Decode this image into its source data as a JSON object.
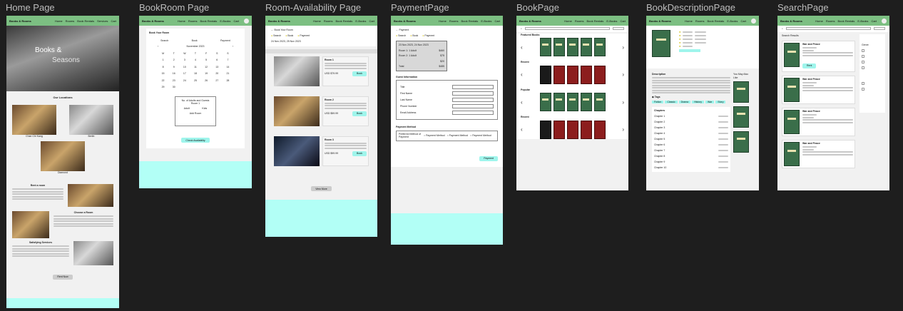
{
  "frames": {
    "home": {
      "label": "Home Page"
    },
    "bookroom": {
      "label": "BookRoom Page"
    },
    "availability": {
      "label": "Room-Availability Page"
    },
    "payment": {
      "label": "PaymentPage"
    },
    "book": {
      "label": "BookPage"
    },
    "description": {
      "label": "BookDescriptionPage"
    },
    "search": {
      "label": "SearchPage"
    }
  },
  "nav": {
    "brand": "Books & Rooms",
    "items": [
      "Home",
      "Rooms",
      "Book Rentals",
      "Services",
      "Cart"
    ],
    "items_alt": [
      "Home",
      "Rooms",
      "Book Rentals",
      "E-Books",
      "Cart"
    ]
  },
  "home": {
    "hero_line1": "Books &",
    "hero_line2": "Seasons",
    "locations_title": "Our Locations",
    "locations": [
      "Chan Chi Kang",
      "Berlin",
      "Diamond"
    ],
    "rent_title": "Rent a room",
    "choose_title": "Choose a Room",
    "services_title": "Satisfying Services",
    "rent_button": "Rent Now"
  },
  "bookroom": {
    "title": "Book Your Room",
    "steps": [
      "Search",
      "Book",
      "Payment"
    ],
    "month": "November 2023",
    "weekdays": [
      "M",
      "T",
      "W",
      "T",
      "F",
      "S",
      "S"
    ],
    "guests_title": "No. of Adults and Guests",
    "room": "Room 1",
    "adults": "Adult",
    "kids": "Kids",
    "add_room": "Add Room",
    "check_button": "Check Availability"
  },
  "availability": {
    "back": "Book Your Room",
    "steps": [
      "Search",
      "Book",
      "Payment"
    ],
    "dates": "24 Nov 2023, 25 Nov 2023",
    "rooms": [
      {
        "name": "Room 1",
        "price": "USD $79.99",
        "button": "Book"
      },
      {
        "name": "Room 2",
        "price": "USD $59.99",
        "button": "Book"
      },
      {
        "name": "Room 3",
        "price": "USD $99.99",
        "button": "Book"
      }
    ],
    "view_more": "View More"
  },
  "payment": {
    "back": "Payment",
    "steps": [
      "Search",
      "Book",
      "Payment"
    ],
    "summary_dates": "23 Nov 2023, 24 Nov 2023",
    "summary_rows": [
      {
        "label": "Room 1: 1 Adult",
        "value": "$460"
      },
      {
        "label": "Room 2: 1 Adult",
        "value": "$75"
      },
      {
        "label": "",
        "value": "$20"
      },
      {
        "label": "Total",
        "value": "$485"
      }
    ],
    "guest_title": "Guest Information",
    "fields": [
      "Title",
      "First Name",
      "Last Name",
      "Phone Number",
      "Email Address"
    ],
    "method_title": "Payment Method",
    "preferred": "Preferred Method of Payment",
    "methods": [
      "Payment Method",
      "Payment Method",
      "Payment Method"
    ],
    "pay_button": "Payment"
  },
  "book": {
    "sections": [
      "Featured Books",
      "Recent",
      "Popular",
      "Recent"
    ]
  },
  "description": {
    "description_title": "Description",
    "tags_title": "Tags",
    "tags": [
      "Fiction",
      "Classic",
      "Drama",
      "History",
      "War",
      "Story"
    ],
    "chapters_title": "Chapters",
    "chapters": [
      "Chapter 1",
      "Chapter 2",
      "Chapter 3",
      "Chapter 4",
      "Chapter 5",
      "Chapter 6",
      "Chapter 7",
      "Chapter 8",
      "Chapter 9",
      "Chapter 10"
    ],
    "side_title": "You May Also Like"
  },
  "search": {
    "results_title": "Search Results",
    "results": [
      {
        "title": "War and Peace",
        "button": "Rent"
      },
      {
        "title": "War and Peace",
        "button": ""
      },
      {
        "title": "War and Peace",
        "button": ""
      },
      {
        "title": "War and Peace",
        "button": ""
      }
    ],
    "filter_title": "Genre"
  },
  "colors": {
    "nav": "#7cbf82",
    "footer": "#b2fff6",
    "canvas": "#1e1e1e"
  }
}
